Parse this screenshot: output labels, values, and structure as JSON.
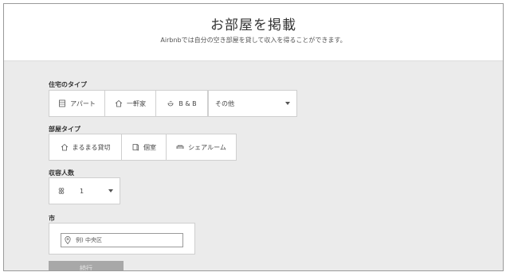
{
  "header": {
    "title": "お部屋を掲載",
    "subtitle": "Airbnbでは自分の空き部屋を貸して収入を得ることができます。"
  },
  "home_type": {
    "label": "住宅のタイプ",
    "options": [
      {
        "label": "アパート",
        "icon": "apartment-icon"
      },
      {
        "label": "一軒家",
        "icon": "house-icon"
      },
      {
        "label": "B & B",
        "icon": "bed-and-breakfast-icon"
      }
    ],
    "other_select": {
      "value": "その他",
      "icon": "chevron-down-icon"
    }
  },
  "room_type": {
    "label": "部屋タイプ",
    "options": [
      {
        "label": "まるまる貸切",
        "icon": "entire-home-icon"
      },
      {
        "label": "個室",
        "icon": "private-room-icon"
      },
      {
        "label": "シェアルーム",
        "icon": "shared-room-icon"
      }
    ]
  },
  "capacity": {
    "label": "収容人数",
    "value": "1",
    "icon": "people-icon"
  },
  "city": {
    "label": "市",
    "placeholder": "例) 中央区",
    "icon": "location-pin-icon"
  },
  "next_button": {
    "label": "続行"
  },
  "colors": {
    "page_background": "#ebebeb",
    "panel_background": "#ffffff",
    "button_disabled": "#a8a8a8"
  }
}
